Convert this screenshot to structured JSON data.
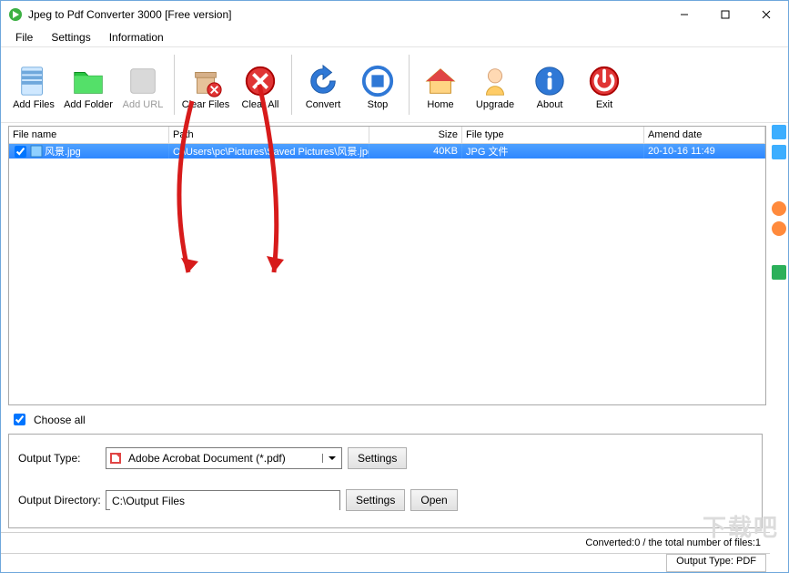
{
  "title": "Jpeg to Pdf Converter 3000 [Free version]",
  "menu": {
    "file": "File",
    "settings": "Settings",
    "information": "Information"
  },
  "toolbar": {
    "add_files": "Add Files",
    "add_folder": "Add Folder",
    "add_url": "Add URL",
    "clear_files": "Clear Files",
    "clear_all": "Clear All",
    "convert": "Convert",
    "stop": "Stop",
    "home": "Home",
    "upgrade": "Upgrade",
    "about": "About",
    "exit": "Exit"
  },
  "columns": {
    "file_name": "File name",
    "path": "Path",
    "size": "Size",
    "file_type": "File type",
    "amend_date": "Amend date"
  },
  "row0": {
    "name": "风景.jpg",
    "path": "C:\\Users\\pc\\Pictures\\Saved Pictures\\风景.jpg",
    "size": "40KB",
    "type": "JPG 文件",
    "date": "20-10-16 11:49"
  },
  "choose_all": "Choose all",
  "output": {
    "type_label": "Output Type:",
    "type_value": "Adobe Acrobat Document (*.pdf)",
    "dir_label": "Output Directory:",
    "dir_value": "C:\\Output Files",
    "settings_btn": "Settings",
    "open_btn": "Open"
  },
  "status": {
    "summary": "Converted:0  /  the total number of files:1",
    "output_type": "Output Type: PDF"
  },
  "watermark": "下载吧",
  "colors": {
    "selection": "#2e87ff",
    "accent": "#6fa8dc"
  }
}
